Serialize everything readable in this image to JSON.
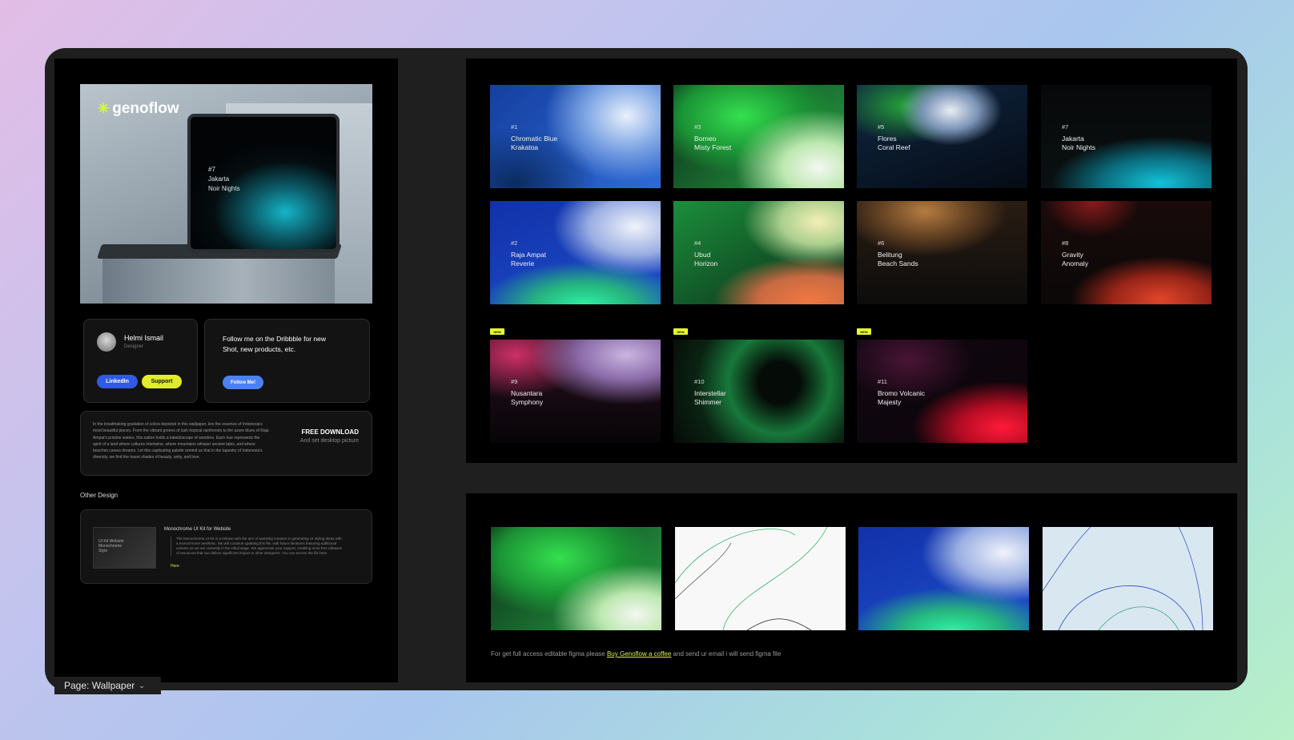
{
  "hero": {
    "logo_text": "genoflow",
    "screen_number": "#7",
    "screen_name_line1": "Jakarta",
    "screen_name_line2": "Noir Nights"
  },
  "profile": {
    "name": "Helmi Ismail",
    "role": "Designer",
    "linkedin_label": "LinkedIn",
    "support_label": "Support"
  },
  "follow": {
    "text": "Follow me on the Dribbble for new Shot, new products, etc.",
    "button_label": "Follow Me!"
  },
  "download": {
    "body": "In the breathtaking gradation of colors depicted in this wallpaper, lies the essence of Indonesia's most beautiful places. From the vibrant greens of lush tropical rainforests to the azure blues of Raja Ampat's pristine waters, this nation holds a kaleidoscope of wonders. Each hue represents the spirit of a land where cultures intertwine, where mountains whisper ancient tales, and where beaches caress dreams. Let this captivating palette remind us that in the tapestry of Indonesia's diversity, we find the truest shades of beauty, unity, and love.",
    "title": "FREE DOWNLOAD",
    "subtitle": "And set desktop picture"
  },
  "other_design": {
    "section_label": "Other Design",
    "thumb_text": "UI Kit Website Monochrome Style",
    "title": "Monochrome UI Kit for Website",
    "description": "The Monochrome UI Kit is a release with the aim of assisting creators in generating UI styling ideas with a monochrome aesthetic. We will continue updating this file, with future iterations featuring additional variants as we are currently in the initial stage. We appreciate your support, enabling more free releases of resources that can deliver significant impact to other designers. You can access the file here",
    "link": "Here"
  },
  "wallpapers": [
    {
      "num": "#1",
      "line1": "Chromatic Blue",
      "line2": "Krakatoa",
      "is_new": false
    },
    {
      "num": "#3",
      "line1": "Borneo",
      "line2": "Misty Forest",
      "is_new": false
    },
    {
      "num": "#5",
      "line1": "Flores",
      "line2": "Coral Reef",
      "is_new": false
    },
    {
      "num": "#7",
      "line1": "Jakarta",
      "line2": "Noir Nights",
      "is_new": false
    },
    {
      "num": "#2",
      "line1": "Raja Ampat",
      "line2": "Reverie",
      "is_new": false
    },
    {
      "num": "#4",
      "line1": "Ubud",
      "line2": "Horizon",
      "is_new": false
    },
    {
      "num": "#6",
      "line1": "Belitung",
      "line2": "Beach Sands",
      "is_new": false
    },
    {
      "num": "#8",
      "line1": "Gravity",
      "line2": "Anomaly",
      "is_new": false
    },
    {
      "num": "#9",
      "line1": "Nusantara",
      "line2": "Symphony",
      "is_new": true
    },
    {
      "num": "#10",
      "line1": "Interstellar",
      "line2": "Shimmer",
      "is_new": true
    },
    {
      "num": "#11",
      "line1": "Bromo Volcanic",
      "line2": "Majesty",
      "is_new": true
    }
  ],
  "new_badge_label": "NEW",
  "footer": {
    "before": "For get full access editable figma please ",
    "link": "Buy Genoflow a coffee",
    "after": " and send ur email i will send figma file"
  },
  "page_tab": {
    "label": "Page: Wallpaper"
  },
  "colors": {
    "accent_yellow": "#dfee2b",
    "linkedin_blue": "#2f5ae6",
    "follow_blue": "#4b82f2",
    "panel_black": "#000000",
    "canvas_gray": "#1f1f1f"
  }
}
